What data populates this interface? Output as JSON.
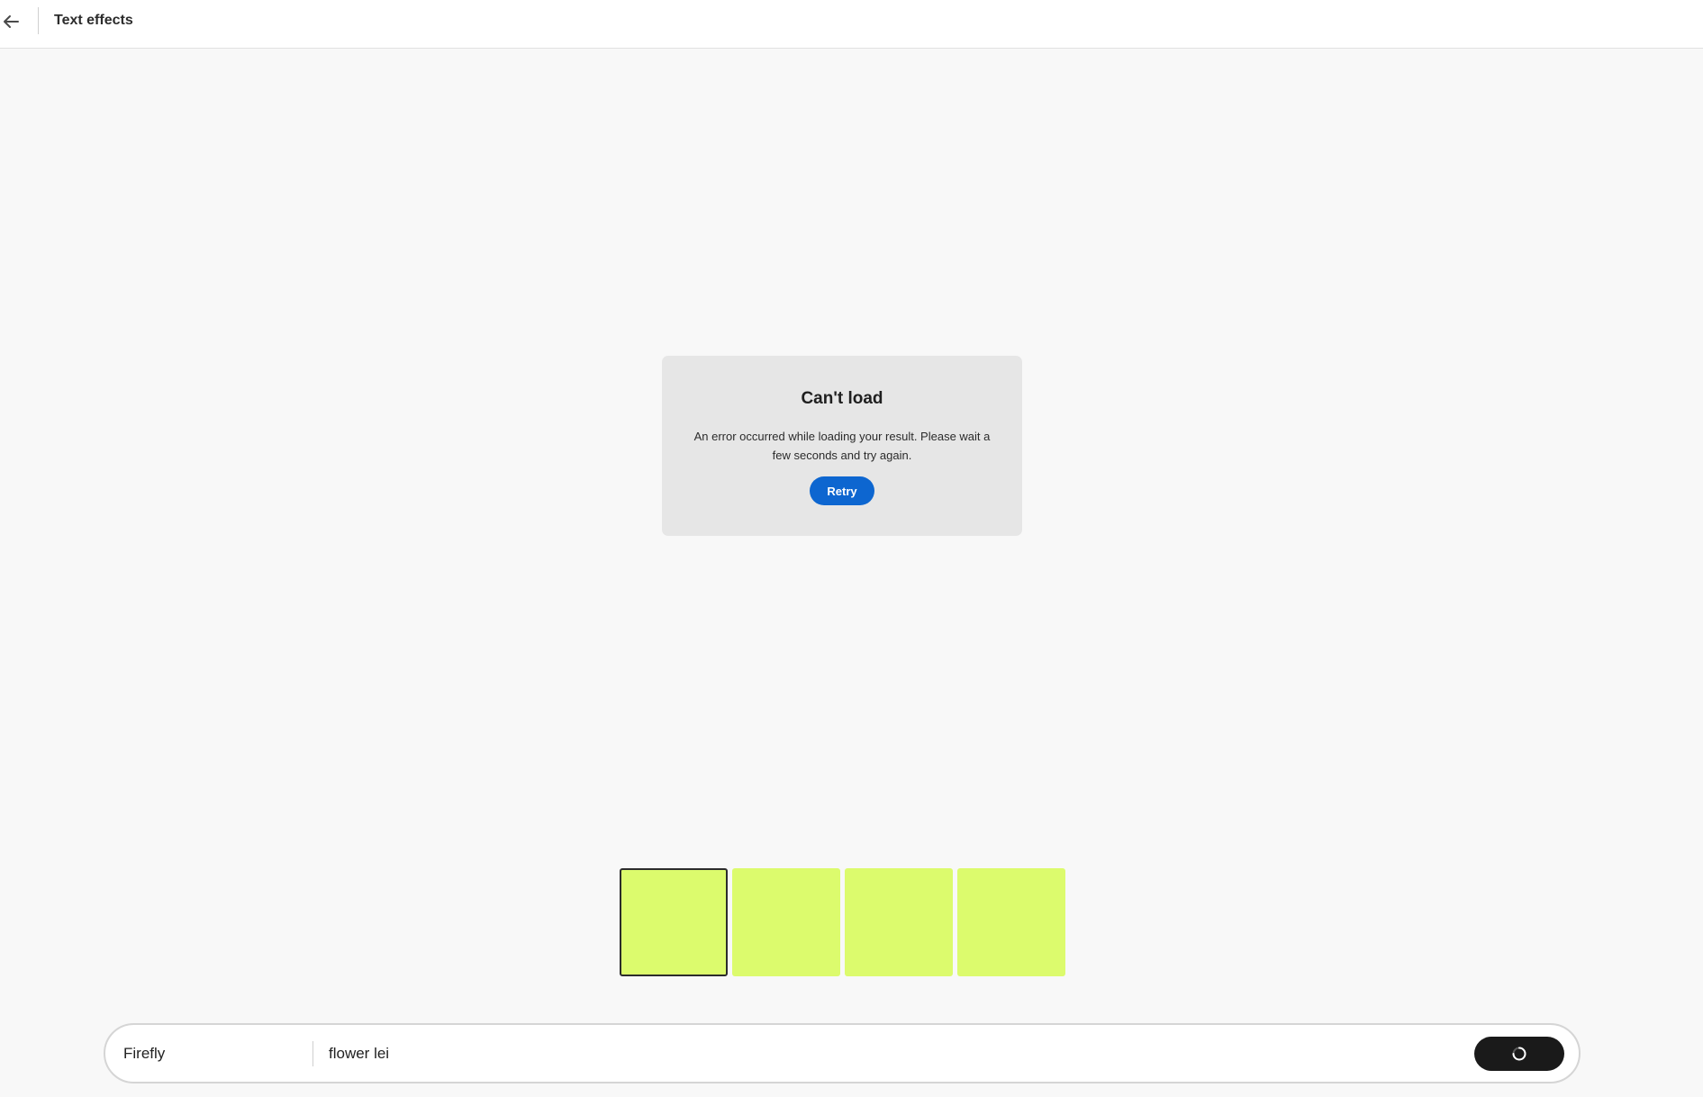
{
  "header": {
    "title": "Text effects",
    "back_icon": "arrow-left-icon"
  },
  "error": {
    "title": "Can't load",
    "message": "An error occurred while loading your result. Please wait a few seconds and try again.",
    "retry_label": "Retry"
  },
  "thumbnails": {
    "count": 4,
    "selected_index": 0,
    "color": "#dcfb6d"
  },
  "prompt": {
    "model_label": "Firefly",
    "value": "flower lei",
    "generate_icon": "loading-spinner-icon"
  },
  "colors": {
    "accent": "#0d66d0",
    "background": "#f8f8f8",
    "generate_button": "#1a1a1a"
  }
}
